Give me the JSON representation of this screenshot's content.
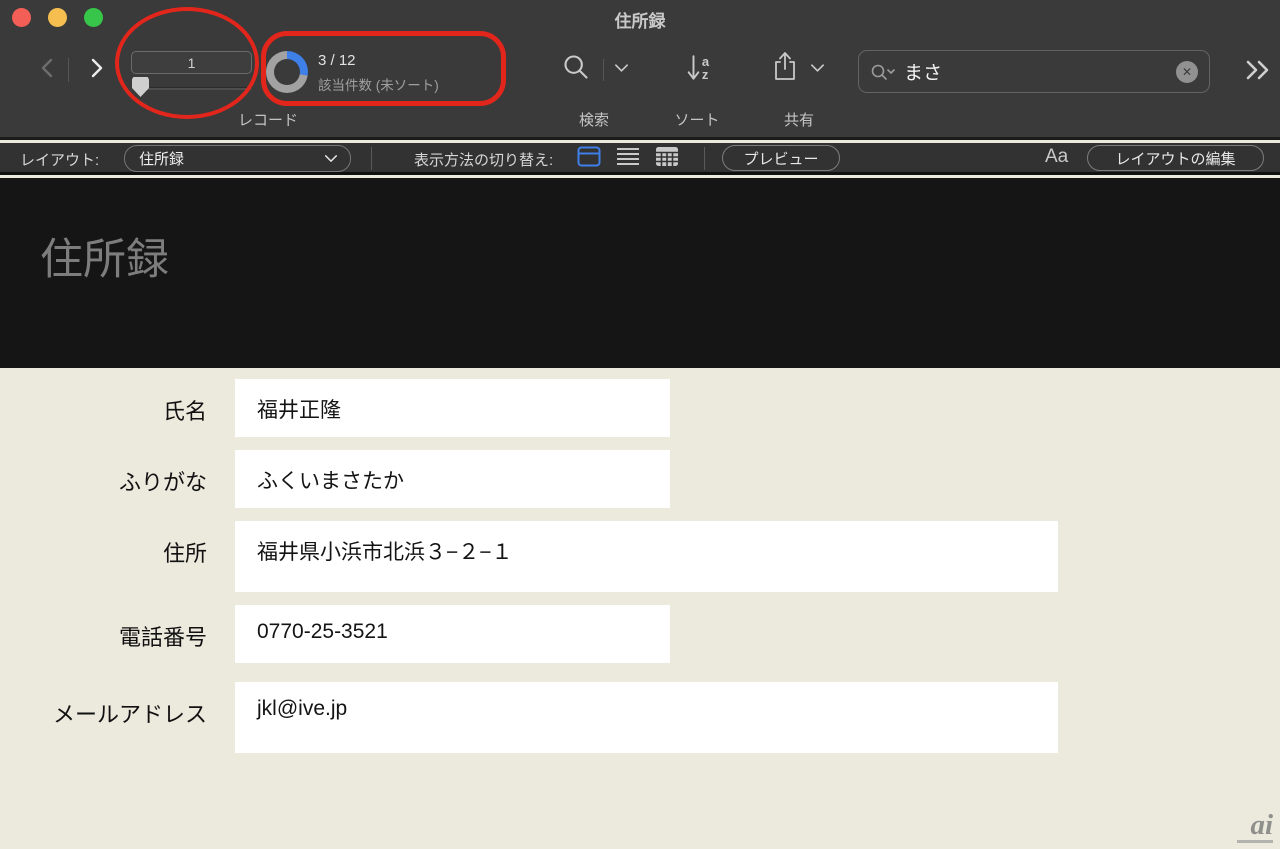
{
  "window": {
    "title": "住所録"
  },
  "toolbar": {
    "record_number": "1",
    "record_label": "レコード",
    "found_count": "3 / 12",
    "found_status": "該当件数 (未ソート)",
    "search_label": "検索",
    "sort_label": "ソート",
    "sort_letter_top": "a",
    "sort_letter_bottom": "z",
    "share_label": "共有",
    "search_field_value": "まさ",
    "clear_glyph": "✕"
  },
  "layout_bar": {
    "layout_label": "レイアウト:",
    "layout_selected": "住所録",
    "view_switch_label": "表示方法の切り替え:",
    "preview_button": "プレビュー",
    "format_label": "Aa",
    "edit_layout_button": "レイアウトの編集"
  },
  "content": {
    "header_title": "住所録",
    "fields": [
      {
        "label": "氏名",
        "value": "福井正隆",
        "wide": false,
        "tall": false
      },
      {
        "label": "ふりがな",
        "value": "ふくいまさたか",
        "wide": false,
        "tall": false
      },
      {
        "label": "住所",
        "value": "福井県小浜市北浜３−２−１",
        "wide": true,
        "tall": true
      },
      {
        "label": "電話番号",
        "value": "0770-25-3521",
        "wide": false,
        "tall": false
      },
      {
        "label": "メールアドレス",
        "value": "jkl@ive.jp",
        "wide": true,
        "tall": true
      }
    ]
  },
  "watermark": {
    "text": "ai"
  },
  "colors": {
    "toolbar_bg": "#3a3a3a",
    "layout_bar_bg": "#323232",
    "content_header_bg": "#151515",
    "form_bg": "#ece9dd",
    "accent_blue": "#3e7fe8",
    "donut_found": "#3e7fe8",
    "donut_total": "#a2a2a2",
    "annotation_red": "#e2261c",
    "traffic_red": "#f35e56",
    "traffic_yellow": "#f6be4f",
    "traffic_green": "#37c649"
  }
}
